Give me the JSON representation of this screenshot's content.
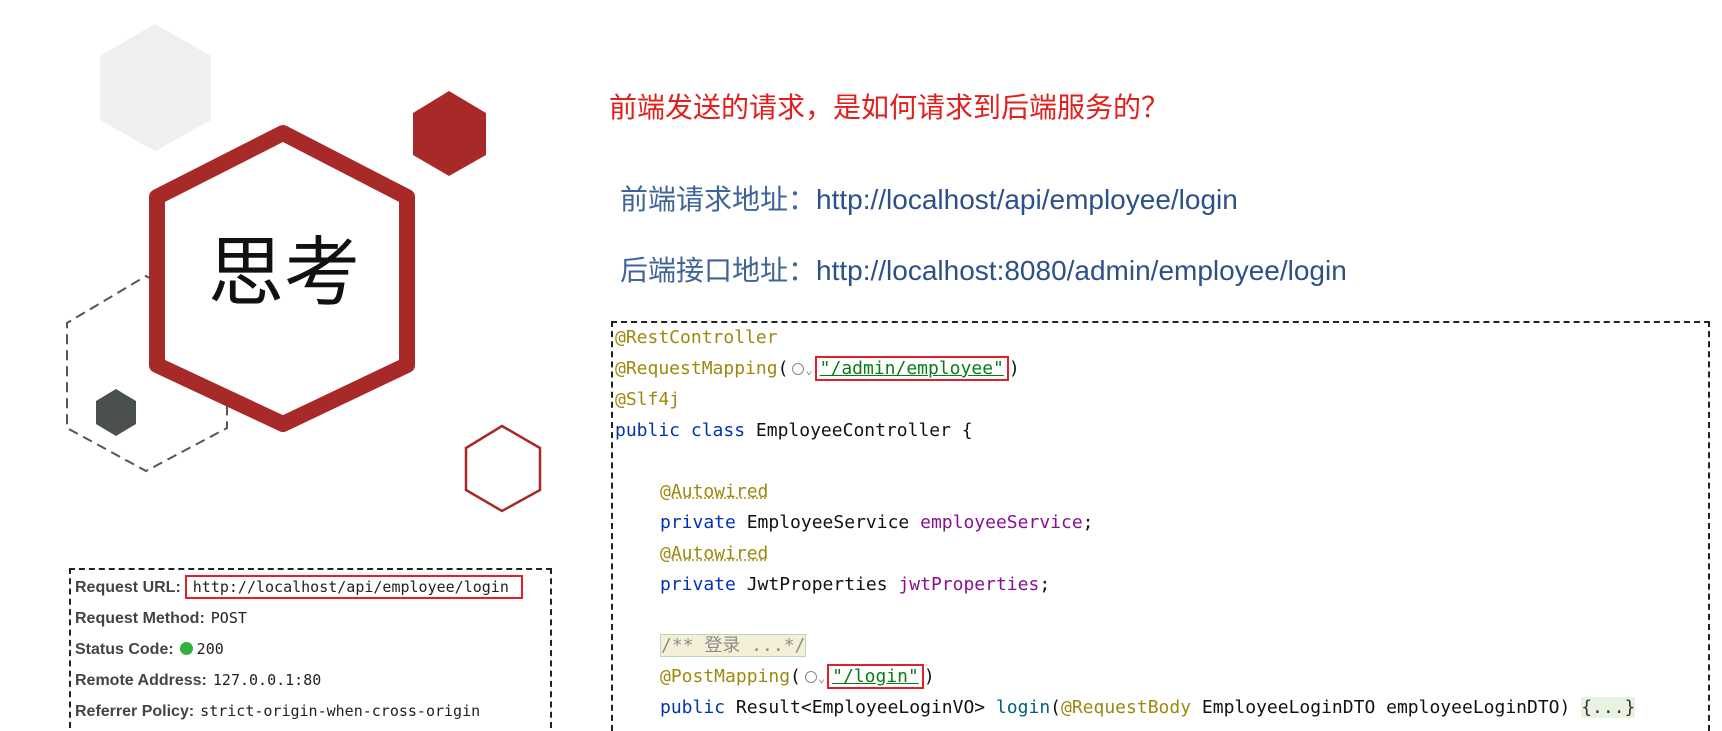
{
  "slide": {
    "think_label": "思考",
    "question": "前端发送的请求，是如何请求到后端服务的？",
    "front_label": "前端请求地址：",
    "front_url": "http://localhost/api/employee/login",
    "back_label": "后端接口地址：",
    "back_url": "http://localhost:8080/admin/employee/login"
  },
  "request_info": {
    "url_label": "Request URL:",
    "url_value": "http://localhost/api/employee/login",
    "method_label": "Request Method:",
    "method_value": "POST",
    "status_label": "Status Code:",
    "status_value": "200",
    "remote_label": "Remote Address:",
    "remote_value": "127.0.0.1:80",
    "referrer_label": "Referrer Policy:",
    "referrer_value": "strict-origin-when-cross-origin"
  },
  "code": {
    "rest_controller": "@RestController",
    "request_mapping": "@RequestMapping",
    "request_mapping_path": "\"/admin/employee\"",
    "slf4j": "@Slf4j",
    "kw_public": "public",
    "kw_class": "class",
    "kw_private": "private",
    "class_name": "EmployeeController {",
    "autowired": "@Autowired",
    "service_type": "EmployeeService",
    "service_field": "employeeService",
    "jwt_type": "JwtProperties",
    "jwt_field": "jwtProperties",
    "comment": "/** 登录 ...*/",
    "post_mapping": "@PostMapping",
    "post_mapping_path": "\"/login\"",
    "return_type": "Result<EmployeeLoginVO>",
    "method_name": "login",
    "request_body": "@RequestBody",
    "param": "EmployeeLoginDTO employeeLoginDTO)",
    "folded_body": "{...}"
  },
  "colors": {
    "accent_red": "#a82a28",
    "dark_gray": "#4a4f50",
    "highlight_red": "#e0202a",
    "question_red": "#e0201c",
    "link_blue": "#2c5088"
  }
}
